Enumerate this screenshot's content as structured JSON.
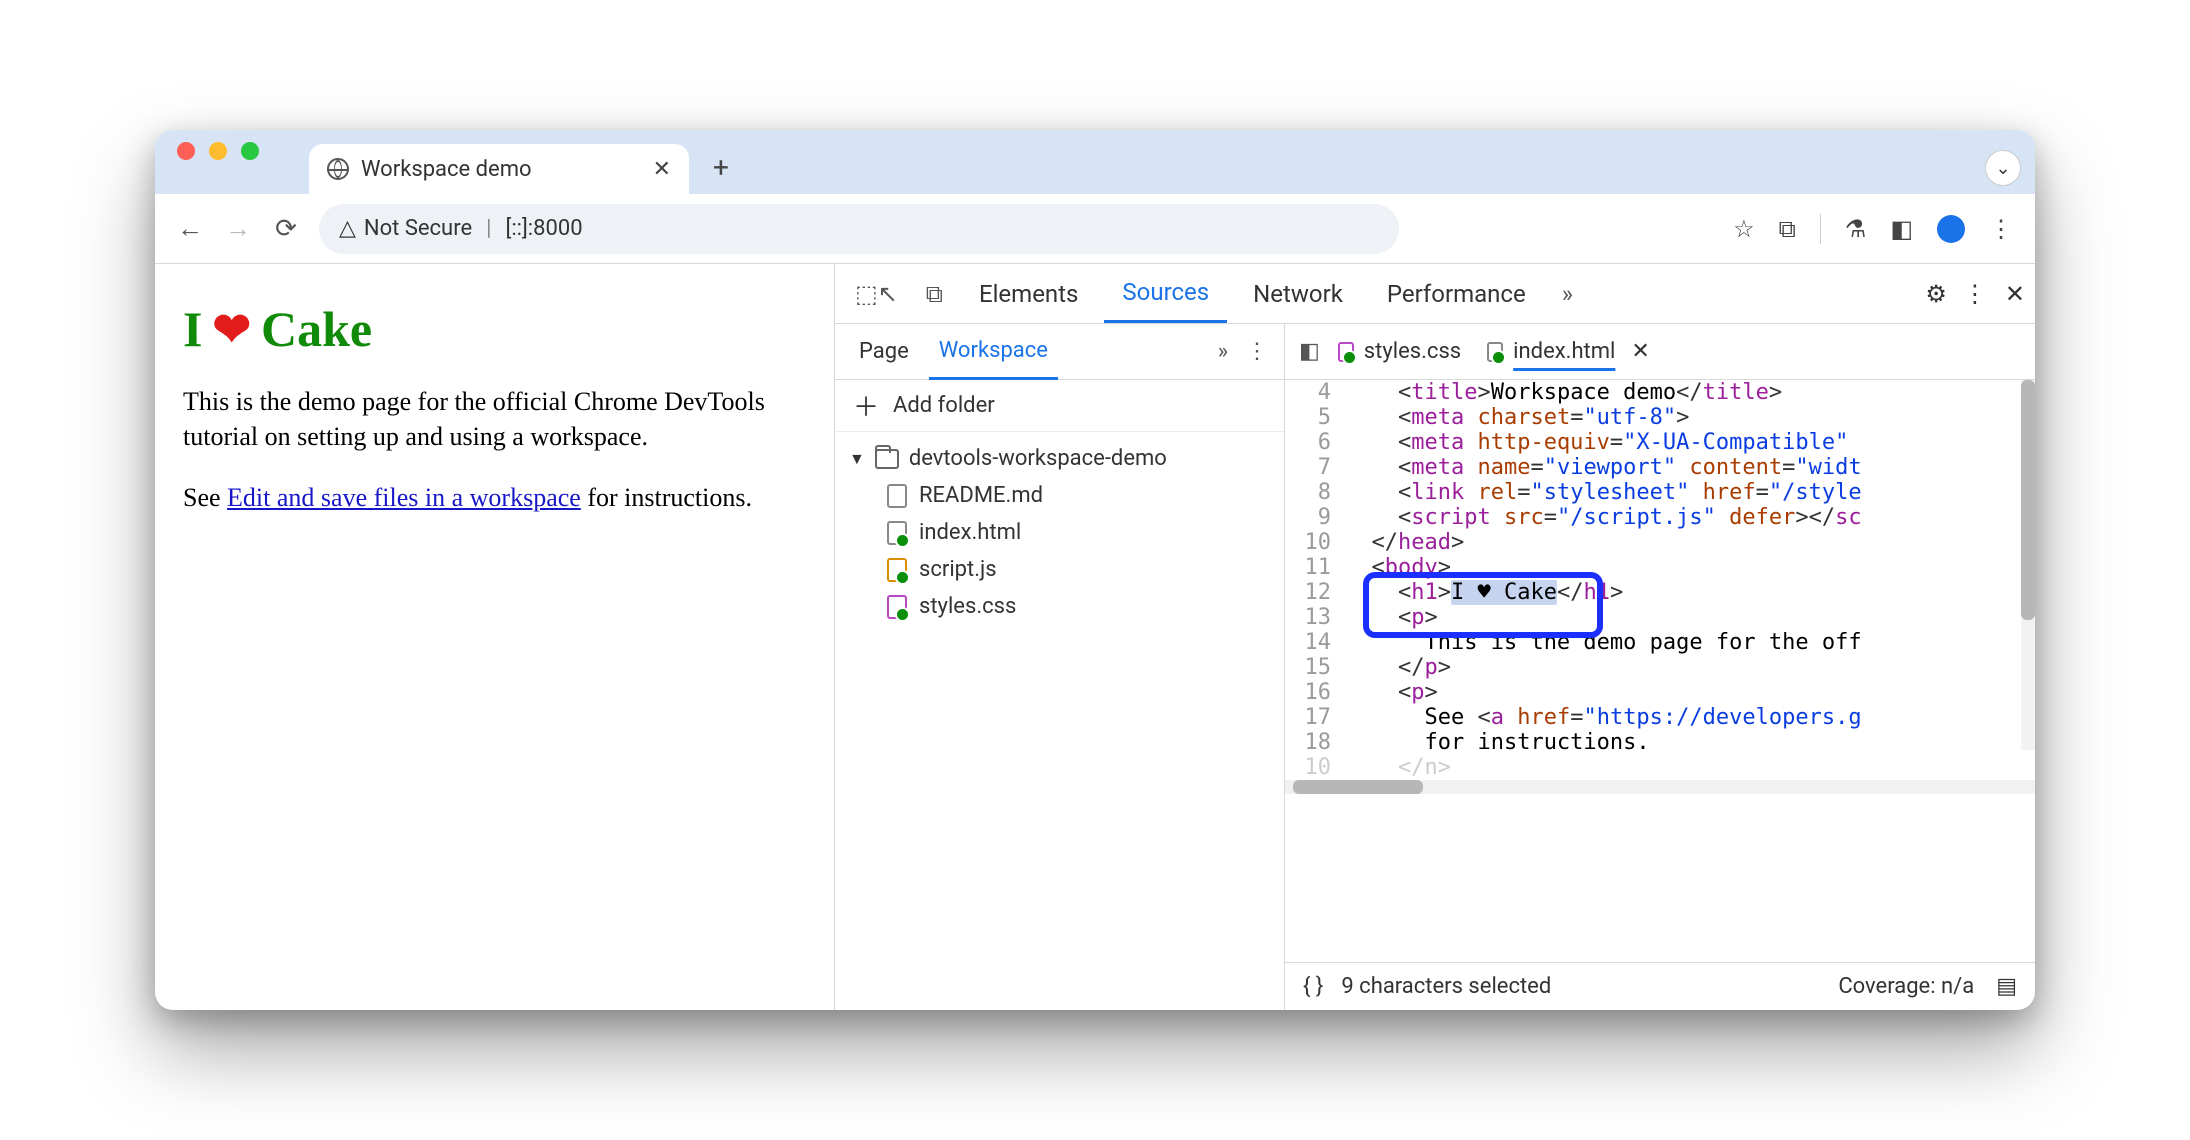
{
  "browser": {
    "tab_title": "Workspace demo",
    "security_label": "Not Secure",
    "url": "[::]:8000"
  },
  "page": {
    "h1_prefix": "I",
    "h1_heart": "❤",
    "h1_suffix": "Cake",
    "p1": "This is the demo page for the official Chrome DevTools tutorial on setting up and using a workspace.",
    "p2_before": "See ",
    "p2_link": "Edit and save files in a workspace",
    "p2_after": " for instructions."
  },
  "devtools": {
    "tabs": {
      "elements": "Elements",
      "sources": "Sources",
      "network": "Network",
      "performance": "Performance"
    },
    "nav": {
      "page_tab": "Page",
      "workspace_tab": "Workspace",
      "add_folder": "Add folder",
      "folder": "devtools-workspace-demo",
      "files": {
        "readme": "README.md",
        "index": "index.html",
        "script": "script.js",
        "styles": "styles.css"
      }
    },
    "editor": {
      "tab_styles": "styles.css",
      "tab_index": "index.html",
      "lines": {
        "4": "    <title>Workspace demo</title>",
        "5": "    <meta charset=\"utf-8\">",
        "6": "    <meta http-equiv=\"X-UA-Compatible\"",
        "7": "    <meta name=\"viewport\" content=\"widt",
        "8": "    <link rel=\"stylesheet\" href=\"/style",
        "9": "    <script src=\"/script.js\" defer></sc",
        "10": "  </head>",
        "11": "  <body>",
        "12": "    <h1>I ♥ Cake</h1>",
        "13": "    <p>",
        "14": "      This is the demo page for the off",
        "15": "    </p>",
        "16": "    <p>",
        "17": "      See <a href=\"https://developers.g",
        "18": "      for instructions."
      }
    },
    "status": {
      "selected": "9 characters selected",
      "coverage": "Coverage: n/a"
    }
  }
}
